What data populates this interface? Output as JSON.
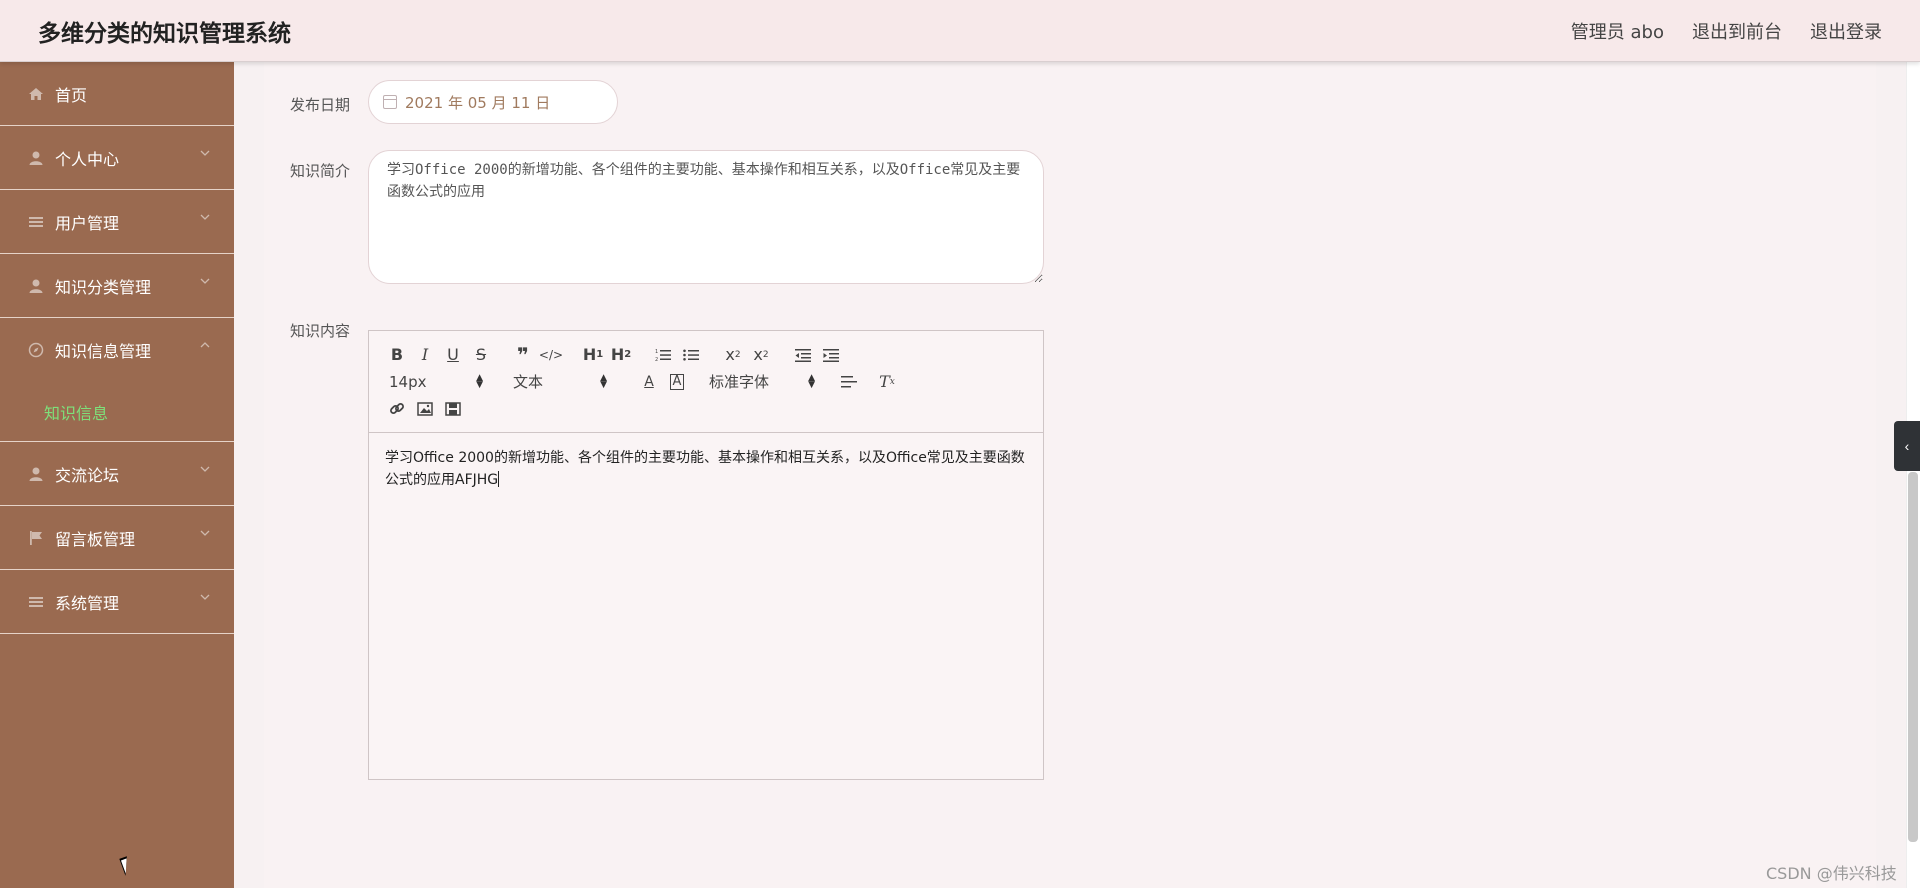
{
  "header": {
    "title": "多维分类的知识管理系统",
    "admin_label": "管理员 abo",
    "back_to_front": "退出到前台",
    "logout": "退出登录"
  },
  "sidebar": {
    "items": [
      {
        "label": "首页",
        "icon": "home-icon"
      },
      {
        "label": "个人中心",
        "icon": "user-icon"
      },
      {
        "label": "用户管理",
        "icon": "list-icon"
      },
      {
        "label": "知识分类管理",
        "icon": "user-icon"
      },
      {
        "label": "知识信息管理",
        "icon": "compass-icon"
      },
      {
        "label": "交流论坛",
        "icon": "user-icon"
      },
      {
        "label": "留言板管理",
        "icon": "flag-icon"
      },
      {
        "label": "系统管理",
        "icon": "list-icon"
      }
    ],
    "submenu_active": "知识信息"
  },
  "form": {
    "date_label": "发布日期",
    "date_value": "2021 年 05 月 11 日",
    "intro_label": "知识简介",
    "intro_value": "学习Office 2000的新增功能、各个组件的主要功能、基本操作和相互关系，以及Office常见及主要函数公式的应用",
    "content_label": "知识内容",
    "editor": {
      "size_select": "14px",
      "type_select": "文本",
      "font_select": "标准字体",
      "body": "学习Office 2000的新增功能、各个组件的主要功能、基本操作和相互关系，以及Office常见及主要函数公式的应用AFJHG"
    }
  },
  "watermark": "CSDN @伟兴科技",
  "colors": {
    "sidebar_bg": "#9a6a50",
    "active_sub": "#7ee07a",
    "header_bg": "#f7e9ea"
  }
}
